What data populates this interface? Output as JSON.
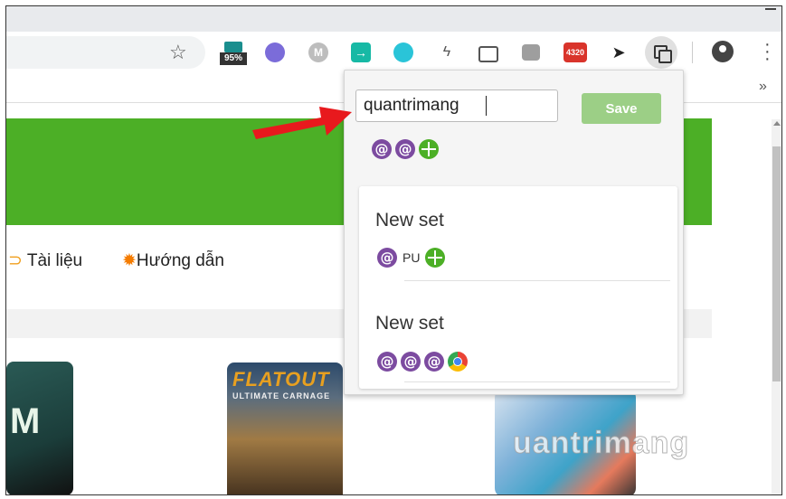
{
  "toolbar": {
    "extension_badge_text": "95%",
    "ext_badge_4320": "4320",
    "icons": [
      "star-icon",
      "extension-badge-icon",
      "purple-square-icon",
      "m-icon",
      "teal-arrow-icon",
      "cyan-circle-icon",
      "bolt-icon",
      "camera-icon",
      "scribble-icon",
      "red-4320-icon",
      "cursor-icon",
      "session-buddy-icon",
      "profile-icon",
      "menu-icon"
    ],
    "chevrons": "»"
  },
  "page": {
    "nav_items": [
      "Tài liệu",
      "Hướng dẫn"
    ],
    "thumb1_letter": "M",
    "thumb2_title": "FLATOUT",
    "thumb2_subtitle": "ULTIMATE CARNAGE",
    "watermark": "uantrimang"
  },
  "popup": {
    "name_value": "quantrimang",
    "save_label": "Save",
    "current_icons": [
      "at-icon",
      "at-icon",
      "globe-icon"
    ],
    "sets": [
      {
        "title": "New set",
        "icons": [
          "at-icon",
          "pu-label",
          "globe-icon"
        ],
        "pu_text": "PU"
      },
      {
        "title": "New set",
        "icons": [
          "at-icon",
          "at-icon",
          "at-icon",
          "chrome-icon"
        ]
      }
    ]
  },
  "colors": {
    "banner_green": "#4caf26",
    "save_green": "#9ccf86",
    "arrow_red": "#e8191d",
    "purple": "#7c4ba0"
  }
}
